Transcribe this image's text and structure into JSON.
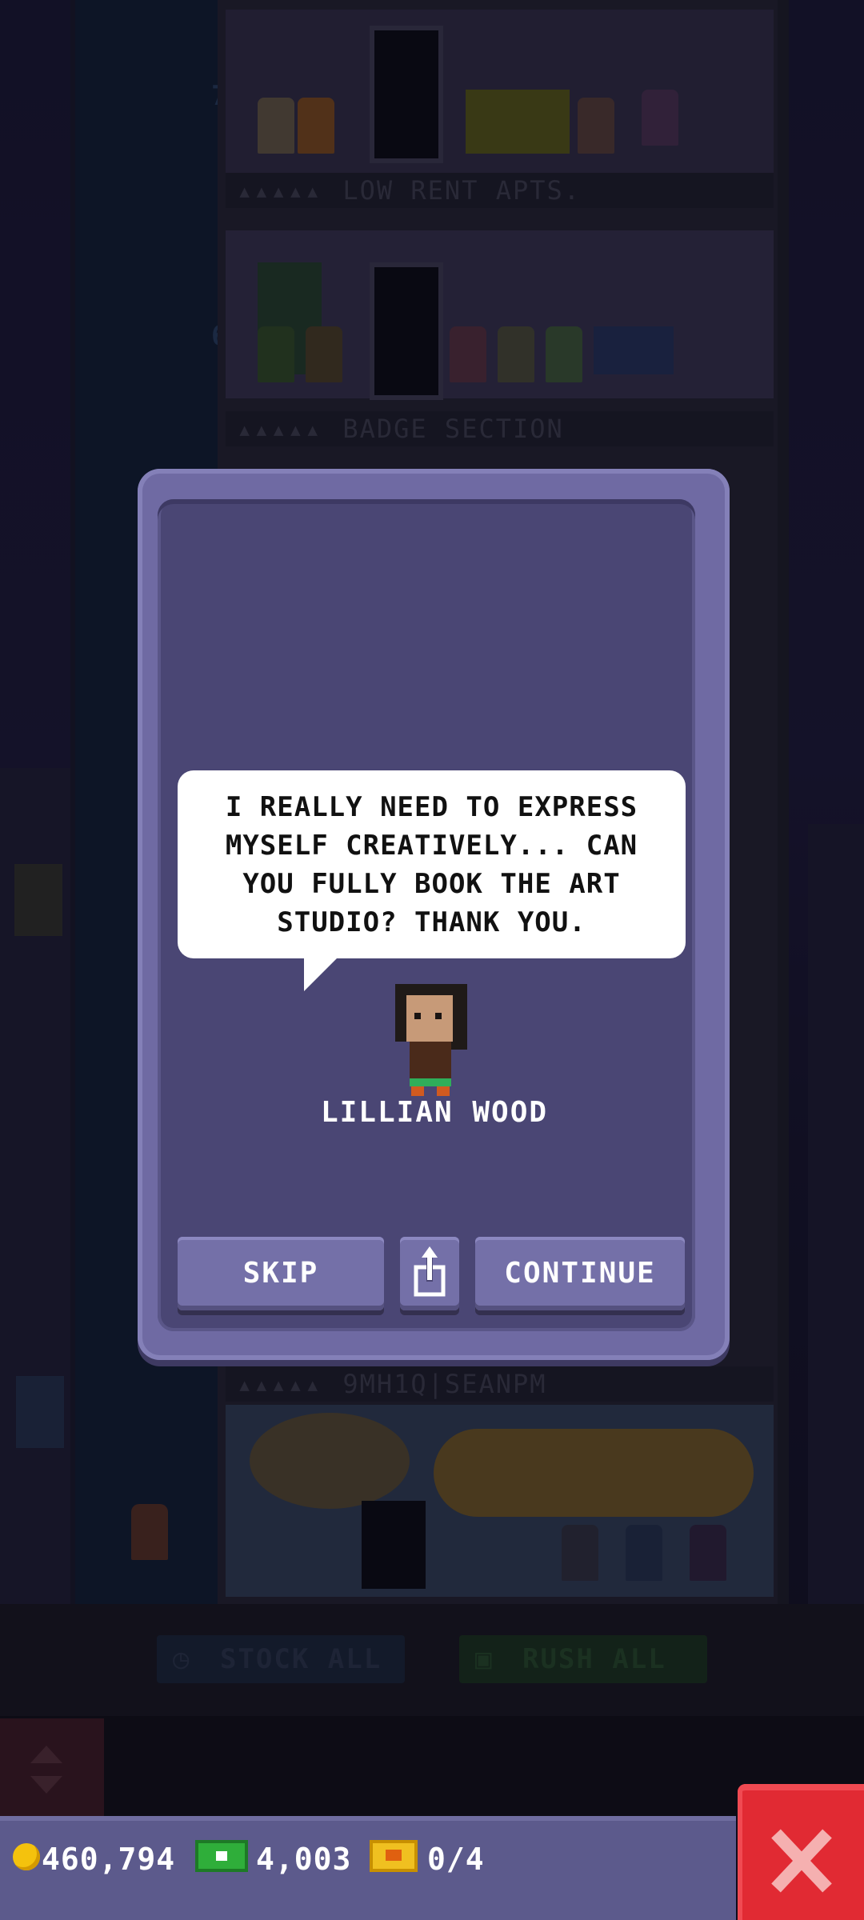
{
  "scene": {
    "floors": [
      {
        "number": "7",
        "label": "LOW RENT APTS."
      },
      {
        "number": "6",
        "label": "BADGE SECTION"
      },
      {
        "number": "",
        "label": "9MH1Q|SEANPM"
      }
    ],
    "actions": {
      "stock_all_label": "STOCK ALL",
      "rush_all_label": "RUSH ALL"
    }
  },
  "dialog": {
    "message": "I REALLY NEED TO EXPRESS MYSELF CREATIVELY... CAN YOU FULLY BOOK THE ART STUDIO? THANK YOU.",
    "character_name": "LILLIAN WOOD",
    "buttons": {
      "skip_label": "SKIP",
      "share_icon": "share-icon",
      "continue_label": "CONTINUE"
    }
  },
  "status": {
    "coins": "460,794",
    "bux": "4,003",
    "tickets": "0/4"
  },
  "colors": {
    "dialog_frame": "#6f6aa3",
    "dialog_panel": "#4a4674",
    "button": "#7470a8",
    "status_bar": "#5c5a8c",
    "close_button": "#e12a33",
    "coin": "#f4c20d",
    "bux": "#2fae3a",
    "ticket": "#f0c020"
  }
}
